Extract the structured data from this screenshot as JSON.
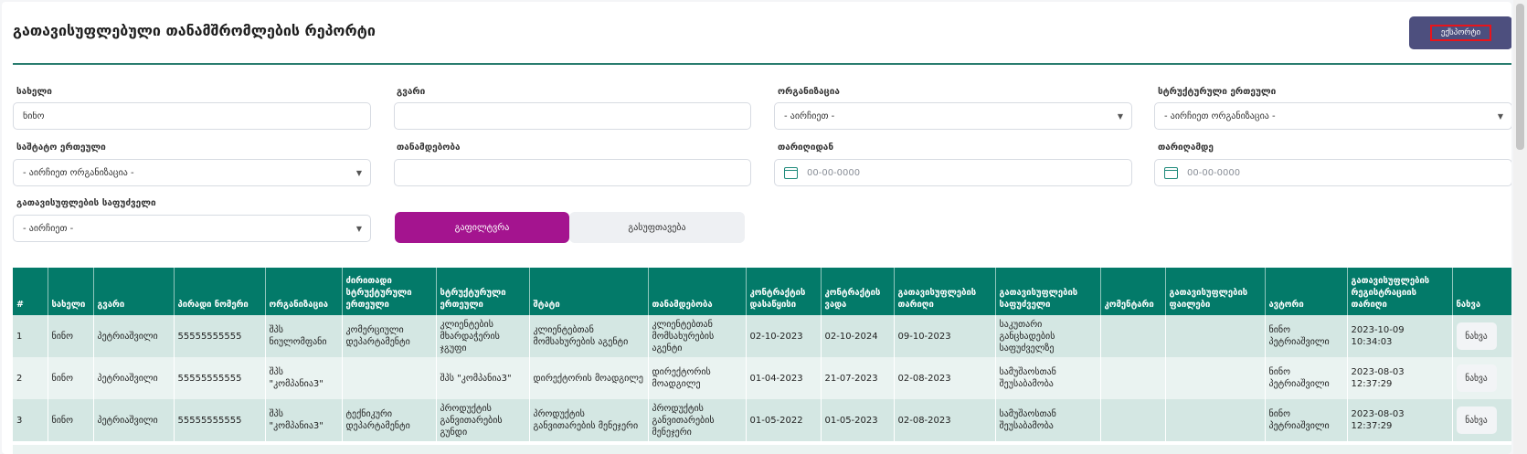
{
  "page": {
    "title": "გათავისუფლებული თანამშრომლების რეპორტი",
    "export_label": "ექსპორტი"
  },
  "filters": {
    "name": {
      "label": "სახელი",
      "value": "ნინო"
    },
    "surname": {
      "label": "გვარი",
      "value": ""
    },
    "organization": {
      "label": "ორგანიზაცია",
      "value": "- აირჩიეთ -"
    },
    "structural_unit": {
      "label": "სტრუქტურული ერთეული",
      "value": "- აირჩიეთ ორგანიზაცია -"
    },
    "staff_unit": {
      "label": "საშტატო ერთეული",
      "value": "- აირჩიეთ ორგანიზაცია -"
    },
    "position": {
      "label": "თანამდებობა",
      "value": ""
    },
    "date_from": {
      "label": "თარიღიდან",
      "placeholder": "00-00-0000"
    },
    "date_to": {
      "label": "თარიღამდე",
      "placeholder": "00-00-0000"
    },
    "release_basis": {
      "label": "გათავისუფლების საფუძველი",
      "value": "- აირჩიეთ -"
    }
  },
  "actions": {
    "filter_label": "გაფილტვრა",
    "clear_label": "გასუფთავება"
  },
  "table": {
    "columns": [
      "#",
      "სახელი",
      "გვარი",
      "პირადი ნომერი",
      "ორგანიზაცია",
      "ძირითადი სტრუქტურული ერთეული",
      "სტრუქტურული ერთეული",
      "შტატი",
      "თანამდებობა",
      "კონტრაქტის დასაწყისი",
      "კონტრაქტის ვადა",
      "გათავისუფლების თარიღი",
      "გათავისუფლების საფუძველი",
      "კომენტარი",
      "გათავისუფლების ფაილები",
      "ავტორი",
      "გათავისუფლების რეგისტრაციის თარიღი",
      "ნახვა"
    ],
    "rows": [
      {
        "num": "1",
        "name": "ნინო",
        "surname": "პეტრიაშვილი",
        "personal_id": "55555555555",
        "organization": "შპს ნიულომფანი",
        "main_unit": "კომერციული დეპარტამენტი",
        "unit": "კლიენტების მხარდაჭერის ჯგუფი",
        "staff": "კლიენტებთან მომსახურების აგენტი",
        "position": "კლიენტებთან მომსახურების აგენტი",
        "contract_start": "02-10-2023",
        "contract_end": "02-10-2024",
        "release_date": "09-10-2023",
        "release_basis": "საკუთარი განცხადების საფუძველზე",
        "comment": "",
        "files": "",
        "author": "ნინო პეტრიაშვილი",
        "registration_date": "2023-10-09 10:34:03",
        "view": "ნახვა"
      },
      {
        "num": "2",
        "name": "ნინო",
        "surname": "პეტრიაშვილი",
        "personal_id": "55555555555",
        "organization": "შპს \"კომპანია3\"",
        "main_unit": "",
        "unit": "შპს \"კომპანია3\"",
        "staff": "დირექტორის მოადგილე",
        "position": "დირექტორის მოადგილე",
        "contract_start": "01-04-2023",
        "contract_end": "21-07-2023",
        "release_date": "02-08-2023",
        "release_basis": "სამუშაოსთან შეუსაბამობა",
        "comment": "",
        "files": "",
        "author": "ნინო პეტრიაშვილი",
        "registration_date": "2023-08-03 12:37:29",
        "view": "ნახვა"
      },
      {
        "num": "3",
        "name": "ნინო",
        "surname": "პეტრიაშვილი",
        "personal_id": "55555555555",
        "organization": "შპს \"კომპანია3\"",
        "main_unit": "ტექნიკური დეპარტამენტი",
        "unit": "პროდუქტის განვითარების გუნდი",
        "staff": "პროდუქტის განვითარების მენეჯერი",
        "position": "პროდუქტის განვითარების მენეჯერი",
        "contract_start": "01-05-2022",
        "contract_end": "01-05-2023",
        "release_date": "02-08-2023",
        "release_basis": "სამუშაოსთან შეუსაბამობა",
        "comment": "",
        "files": "",
        "author": "ნინო პეტრიაშვილი",
        "registration_date": "2023-08-03 12:37:29",
        "view": "ნახვა"
      }
    ]
  },
  "colors": {
    "primary_teal": "#037a69",
    "filter_magenta": "#a4148f",
    "export_navy": "#4d4f7e",
    "row_odd": "#d4e7e3",
    "row_even": "#eaf3f1"
  },
  "icons": {
    "date_field": "calendar-icon",
    "select_field": "chevron-down-icon"
  }
}
